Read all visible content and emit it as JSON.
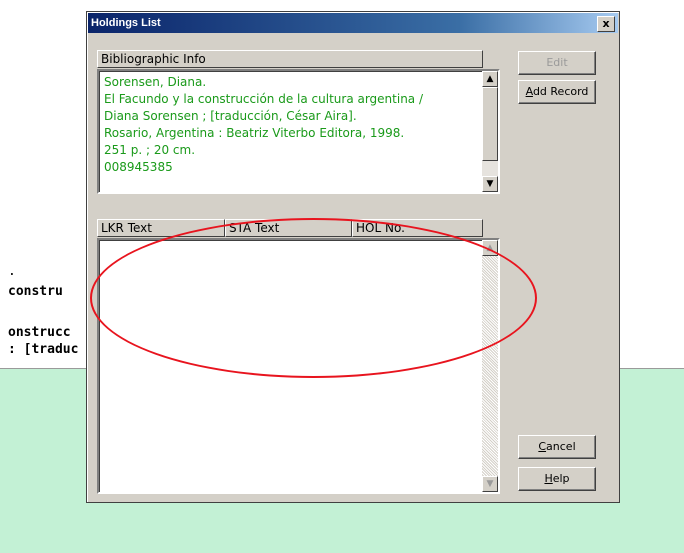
{
  "background": {
    "lines": [
      ".",
      "constru",
      "onstrucc",
      ": [traduc"
    ]
  },
  "dialog": {
    "title": "Holdings List",
    "close_glyph": "x",
    "bib_header": "Bibliographic Info",
    "bib_lines": [
      "Sorensen, Diana.",
      "El Facundo y la construcción de la cultura argentina /",
      "Diana Sorensen ; [traducción, César Aira].",
      " Rosario, Argentina : Beatriz Viterbo Editora, 1998.",
      " 251 p. ; 20 cm.",
      "008945385"
    ],
    "columns": [
      "LKR Text",
      "STA Text",
      "HOL No."
    ],
    "buttons": {
      "edit": "Edit",
      "add_record": "Add Record",
      "cancel": "Cancel",
      "help": "Help"
    }
  },
  "colors": {
    "bib_text": "#1a9a1a",
    "highlight": "#e8141e",
    "background_panel": "#c3f1d5"
  }
}
